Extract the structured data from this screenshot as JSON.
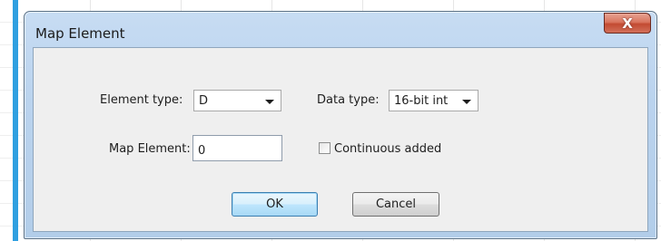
{
  "dialog": {
    "title": "Map Element",
    "close_label": "X"
  },
  "form": {
    "element_type_label": "Element type:",
    "element_type_value": "D",
    "data_type_label": "Data type:",
    "data_type_value": "16-bit int",
    "map_element_label": "Map Element:",
    "map_element_value": "0",
    "continuous_added_label": "Continuous added",
    "continuous_added_checked": false
  },
  "buttons": {
    "ok_label": "OK",
    "cancel_label": "Cancel"
  },
  "colors": {
    "window_frame": "#b9d1ea",
    "close_button": "#c7503a",
    "client_area": "#efefef",
    "left_accent_bar": "#2f9fe0"
  }
}
